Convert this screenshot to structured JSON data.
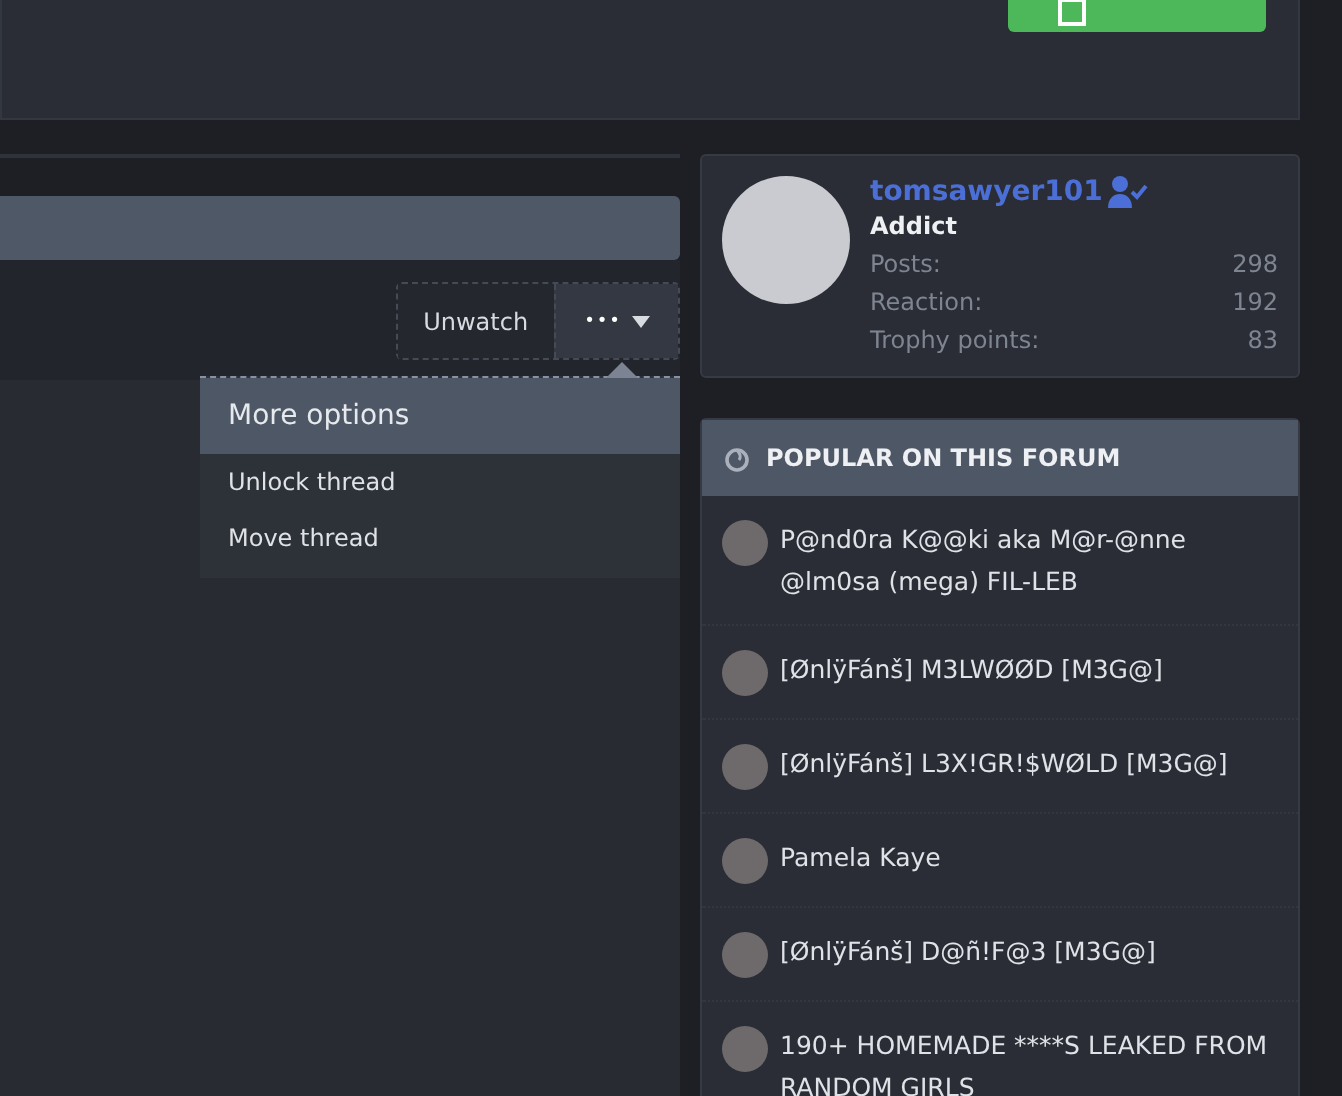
{
  "thread_actions": {
    "buttons": [
      {
        "label": "Unwatch",
        "kind": "text"
      },
      {
        "label": "•••",
        "kind": "menu",
        "expanded": true
      }
    ]
  },
  "more_options_menu": {
    "title": "More options",
    "items": [
      "Unlock thread",
      "Move thread"
    ]
  },
  "user_card": {
    "username": "tomsawyer101",
    "verified": true,
    "title": "Addict",
    "stats": [
      {
        "label": "Posts:",
        "value": "298"
      },
      {
        "label": "Reaction:",
        "value": "192"
      },
      {
        "label": "Trophy points:",
        "value": "83"
      }
    ]
  },
  "popular": {
    "title": "POPULAR ON THIS FORUM",
    "threads": [
      {
        "title": "P@nd0ra K@@ki aka M@r-@nne @lm0sa (mega) FIL-LEB"
      },
      {
        "title": "[ØnlÿFánš] M3LWØØD [M3G@]"
      },
      {
        "title": "[ØnlÿFánš] L3X!GR!$WØLD [M3G@]"
      },
      {
        "title": "Pamela Kaye"
      },
      {
        "title": "[ØnlÿFánš] D@ñ!F@3 [M3G@]"
      },
      {
        "title": "190+ HOMEMADE ****S LEAKED FROM RANDOM GIRLS"
      }
    ]
  }
}
